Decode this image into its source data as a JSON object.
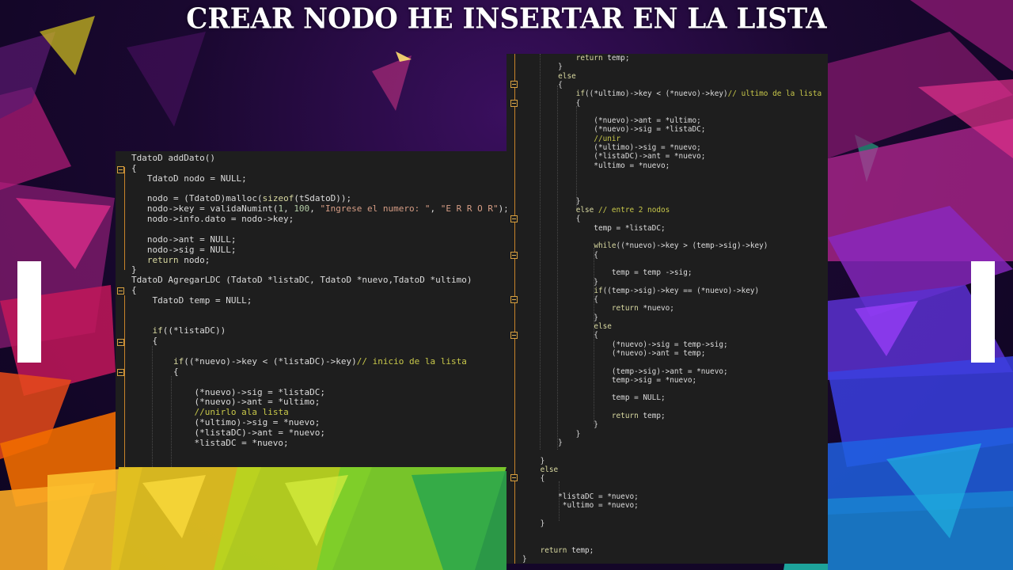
{
  "title": "CREAR NODO HE INSERTAR EN LA LISTA",
  "colors": {
    "code_bg": "#1e1e1e",
    "code_text": "#dcdcdc",
    "string": "#d69d85",
    "comment": "#c8c84a",
    "keyword": "#d8d8a0",
    "number": "#b5cea8",
    "fold_marker": "#d8a040"
  },
  "left_panel": {
    "lines": [
      "TdatoD addDato()",
      "{",
      "   TdatoD nodo = NULL;",
      "",
      "   nodo = (TdatoD)malloc(sizeof(tSdatoD));",
      "   nodo->key = validaNumint(1, 100, \"Ingrese el numero: \", \"E R R O R\");",
      "   nodo->info.dato = nodo->key;",
      "",
      "   nodo->ant = NULL;",
      "   nodo->sig = NULL;",
      "   return nodo;",
      "}",
      "TdatoD AgregarLDC (TdatoD *listaDC, TdatoD *nuevo,TdatoD *ultimo)",
      "{",
      "    TdatoD temp = NULL;",
      "",
      "",
      "    if((*listaDC))",
      "    {",
      "",
      "        if((*nuevo)->key < (*listaDC)->key)// inicio de la lista",
      "        {",
      "",
      "            (*nuevo)->sig = *listaDC;",
      "            (*nuevo)->ant = *ultimo;",
      "            //unirlo ala lista",
      "            (*ultimo)->sig = *nuevo;",
      "            (*listaDC)->ant = *nuevo;",
      "            *listaDC = *nuevo;"
    ]
  },
  "right_panel": {
    "lines": [
      "            return temp;",
      "        }",
      "        else",
      "        {",
      "            if((*ultimo)->key < (*nuevo)->key)// ultimo de la lista",
      "            {",
      "",
      "                (*nuevo)->ant = *ultimo;",
      "                (*nuevo)->sig = *listaDC;",
      "                //unir",
      "                (*ultimo)->sig = *nuevo;",
      "                (*listaDC)->ant = *nuevo;",
      "                *ultimo = *nuevo;",
      "",
      "",
      "",
      "            }",
      "            else // entre 2 nodos",
      "            {",
      "                temp = *listaDC;",
      "",
      "                while((*nuevo)->key > (temp->sig)->key)",
      "                {",
      "",
      "                    temp = temp ->sig;",
      "                }",
      "                if((temp->sig)->key == (*nuevo)->key)",
      "                {",
      "                    return *nuevo;",
      "                }",
      "                else",
      "                {",
      "                    (*nuevo)->sig = temp->sig;",
      "                    (*nuevo)->ant = temp;",
      "",
      "                    (temp->sig)->ant = *nuevo;",
      "                    temp->sig = *nuevo;",
      "",
      "                    temp = NULL;",
      "",
      "                    return temp;",
      "                }",
      "            }",
      "        }",
      "",
      "    }",
      "    else",
      "    {",
      "",
      "        *listaDC = *nuevo;",
      "         *ultimo = *nuevo;",
      "",
      "    }",
      "",
      "",
      "    return temp;",
      "}"
    ]
  }
}
